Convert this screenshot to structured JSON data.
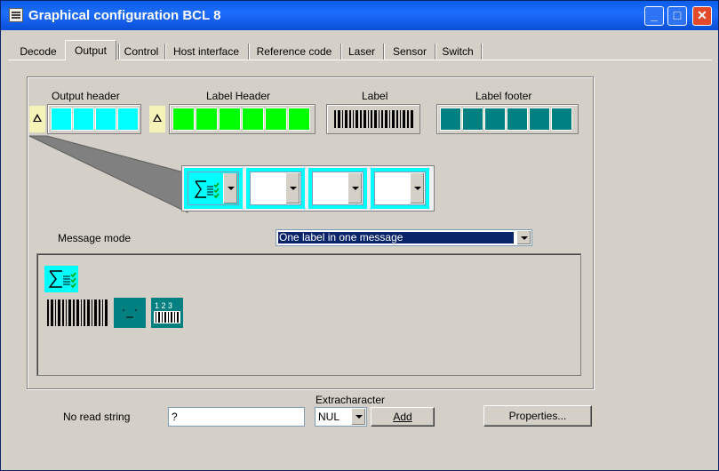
{
  "window": {
    "title": "Graphical configuration BCL 8",
    "title_buttons": {
      "minimize": "_",
      "maximize": "□",
      "close": "✕"
    }
  },
  "tabs": [
    {
      "label": "Decode",
      "active": false
    },
    {
      "label": "Output",
      "active": true
    },
    {
      "label": "Control",
      "active": false
    },
    {
      "label": "Host interface",
      "active": false
    },
    {
      "label": "Reference code",
      "active": false
    },
    {
      "label": "Laser",
      "active": false
    },
    {
      "label": "Sensor",
      "active": false
    },
    {
      "label": "Switch",
      "active": false
    }
  ],
  "segments": {
    "output_header": {
      "label": "Output header",
      "color": "#00ffff",
      "cells": 4
    },
    "label_header": {
      "label": "Label Header",
      "color": "#00ff00",
      "cells": 6
    },
    "label": {
      "label": "Label"
    },
    "label_footer": {
      "label": "Label footer",
      "color": "#008080",
      "cells": 6
    }
  },
  "detail_slots": {
    "count": 4,
    "first_icon": "sum-check-icon"
  },
  "message_mode": {
    "label": "Message mode",
    "value": "One label in one message",
    "highlight": "#0a246a"
  },
  "palette": {
    "items": [
      "sum-check-icon",
      "barcode-icon",
      "footer-icon",
      "numbered-barcode-icon"
    ],
    "numbered_text": "1 2 3"
  },
  "no_read": {
    "label": "No read string",
    "value": "?"
  },
  "extracharacter": {
    "label": "Extracharacter",
    "value": "NUL",
    "add_label": "Add"
  },
  "properties_label": "Properties..."
}
